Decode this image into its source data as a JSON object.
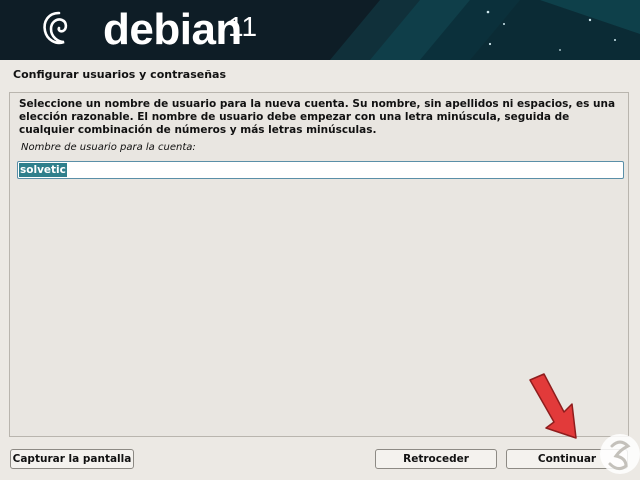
{
  "banner": {
    "brand": "debian",
    "version": "11",
    "background": "#0e1d26",
    "logo_icon": "debian-swirl-icon"
  },
  "section_title": "Configurar usuarios y contraseñas",
  "main": {
    "instructions": "Seleccione un nombre de usuario para la nueva cuenta. Su nombre, sin apellidos ni espacios, es una elección razonable. El nombre de usuario debe empezar con una letra minúscula, seguida de cualquier combinación de números y más letras minúsculas.",
    "field_label": "Nombre de usuario para la cuenta:",
    "username_value": "solvetic",
    "selection_color": "#2f7f8c"
  },
  "buttons": {
    "capture": "Capturar la pantalla",
    "back": "Retroceder",
    "continue": "Continuar"
  },
  "annotation": {
    "arrow_icon": "red-arrow-icon",
    "arrow_color": "#e23a3a"
  },
  "watermark": {
    "icon": "solvetic-logo-icon"
  }
}
